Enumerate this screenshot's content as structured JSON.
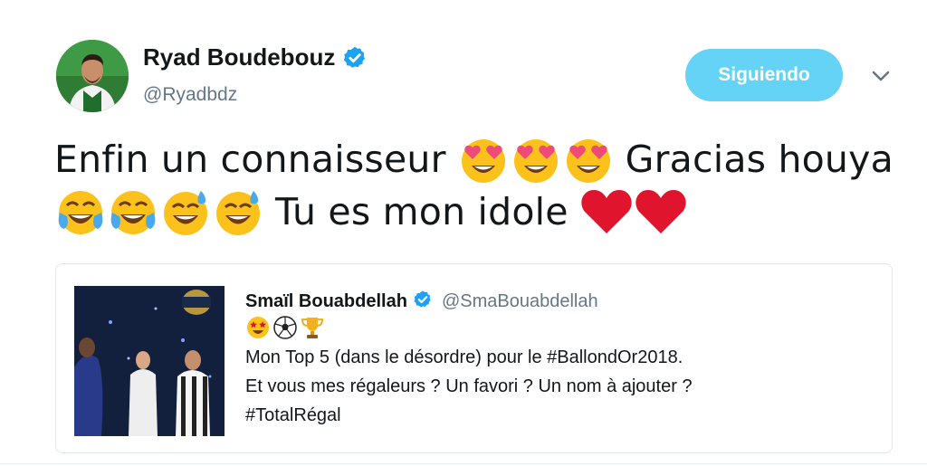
{
  "author": {
    "name": "Ryad Boudebouz",
    "handle": "@Ryadbdz",
    "verified": true,
    "avatar_icon": "profile-avatar"
  },
  "actions": {
    "follow_label": "Siguiendo",
    "menu_icon": "chevron-down-icon"
  },
  "tweet": {
    "line1_text_a": "Enfin un connaisseur",
    "line1_emoji": [
      "heart-eyes-emoji",
      "heart-eyes-emoji",
      "heart-eyes-emoji"
    ],
    "line1_text_b": "Gracias houya",
    "line2_emoji": [
      "tears-of-joy-emoji",
      "tears-of-joy-emoji",
      "sweat-smile-emoji",
      "sweat-smile-emoji"
    ],
    "line2_text": "Tu es mon idole",
    "line2_hearts": [
      "red-heart-emoji",
      "red-heart-emoji"
    ]
  },
  "quoted": {
    "name": "Smaïl Bouabdellah",
    "handle": "@SmaBouabdellah",
    "verified": true,
    "emojis": [
      "star-struck-emoji",
      "soccer-ball-emoji",
      "trophy-emoji"
    ],
    "line1": "Mon Top 5 (dans le désordre) pour le #BallondOr2018.",
    "line2": "Et vous mes régaleurs ? Un favori ? Un nom à ajouter ?",
    "line3": "#TotalRégal"
  },
  "colors": {
    "follow_button": "#64d3f5",
    "verified_blue": "#1da1f2",
    "secondary_text": "#657786",
    "heart_red": "#e0142d"
  }
}
